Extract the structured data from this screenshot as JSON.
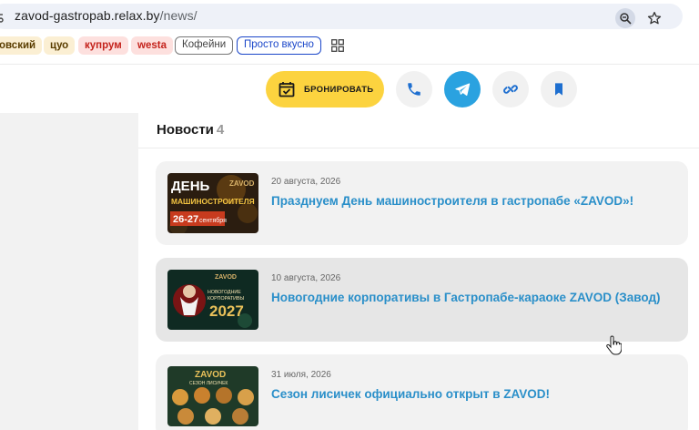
{
  "browser": {
    "url_host": "zavod-gastropab.relax.by",
    "url_path": "/news/"
  },
  "bookmarks": [
    {
      "label": "овский"
    },
    {
      "label": "цуо"
    },
    {
      "label": "купрум"
    },
    {
      "label": "westa"
    },
    {
      "label": "Кофейни"
    },
    {
      "label": "Просто вкусно"
    }
  ],
  "topbar": {
    "book_label": "БРОНИРОВАТЬ",
    "accent_color": "#fcd33f",
    "telegram_color": "#2aa2e0"
  },
  "news": {
    "title": "Новости",
    "count": "4",
    "items": [
      {
        "date": "20 августа, 2026",
        "title": "Празднуем День машиностроителя в гастропабе «ZAVOD»!",
        "thumb_line1": "ДЕНЬ",
        "thumb_line2": "МАШИНОСТРОИТЕЛЯ",
        "thumb_date": "26-27",
        "thumb_month": "сентября",
        "thumb_logo": "ZAVOD"
      },
      {
        "date": "10 августа, 2026",
        "title": "Новогодние корпоративы в Гастропабе-караоке ZAVOD (Завод)",
        "thumb_logo": "ZAVOD",
        "thumb_line1": "НОВОГОДНИЕ",
        "thumb_line2": "КОРПОРАТИВЫ",
        "thumb_year": "2027"
      },
      {
        "date": "31 июля, 2026",
        "title": "Сезон лисичек официально открыт в ZAVOD!",
        "thumb_logo": "ZAVOD",
        "thumb_line1": "СЕЗОН ЛИСИЧЕК"
      }
    ]
  },
  "link_color": "#2a8fc9"
}
